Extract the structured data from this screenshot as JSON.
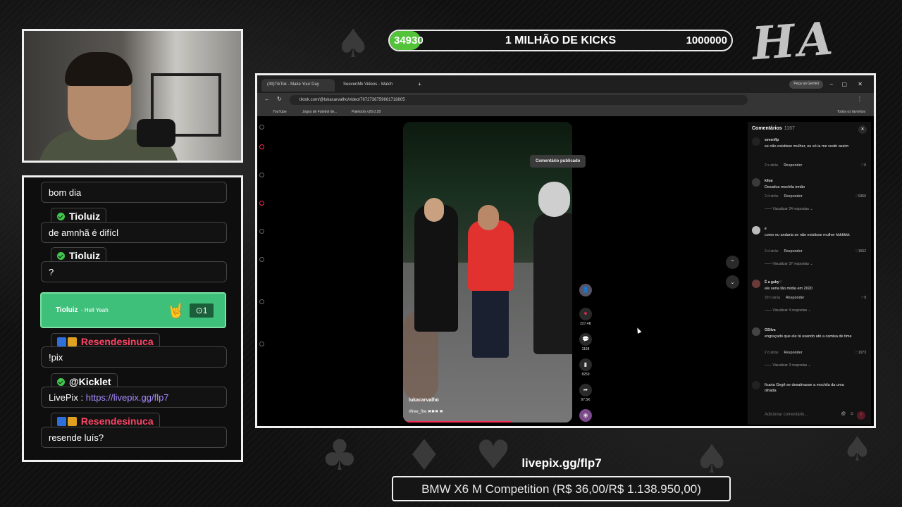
{
  "goal": {
    "current": "34930",
    "title": "1 MILHÃO DE KICKS",
    "target": "1000000",
    "progress_fraction": 0.03493,
    "accent": "#53c43a"
  },
  "overlay_text": "HA HA",
  "chat": {
    "messages": [
      {
        "text": "bom dia"
      },
      {
        "user": "Tioluiz",
        "text": "de amnhã é difícl"
      },
      {
        "user": "Tioluiz",
        "text": "?"
      },
      {
        "user": "Resendesinuca",
        "text": "!pix"
      },
      {
        "user": "@Kicklet",
        "text_prefix": "LivePix : ",
        "link": "https://livepix.gg/flp7"
      },
      {
        "user": "Resendesinuca",
        "text": "resende luís?"
      }
    ],
    "sub_alert": {
      "user": "Tioluiz",
      "text": "- Hell Yeah",
      "count": "1"
    },
    "colors": {
      "verified": "#3fc94d",
      "resende": "#ff4466",
      "link": "#a98bff",
      "alert": "#3fc07a"
    }
  },
  "browser": {
    "tabs": [
      {
        "label": "(39)TikTok - Make Your Day"
      },
      {
        "label": "SeevenMk Videos - Watch"
      }
    ],
    "gemini_label": "Peça ao Gemini",
    "url": "tiktok.com/@lukacarvalho/video/7672738759661718805",
    "bookmarks": [
      "YouTube",
      "Jogos de Futebol de...",
      "Paletools v26.0.28"
    ],
    "all_bookmarks": "Todos os favoritos"
  },
  "video": {
    "user": "lukacarvalho",
    "tags": "#free_fire ✖✖✖ ✖",
    "toast": "Comentário publicado",
    "progress_fraction": 0.64,
    "actions": [
      {
        "icon": "avatar-icon",
        "count": ""
      },
      {
        "icon": "heart-icon",
        "count": "227.4K"
      },
      {
        "icon": "comment-icon",
        "count": "1168"
      },
      {
        "icon": "bookmark-icon",
        "count": "8259"
      },
      {
        "icon": "share-icon",
        "count": "97.5K"
      }
    ]
  },
  "comments": {
    "title": "Comentários",
    "count": "1167",
    "items": [
      {
        "user": "sevenflp",
        "text": "se não existisse mulher, eu só ia me vestir assim",
        "time": "2 s atrás",
        "reply": "Responder",
        "likes": "0"
      },
      {
        "user": "kilua",
        "text": "Desativa mochila irmão",
        "time": "2 d atrás",
        "reply": "Responder",
        "likes": "9360",
        "more": "Visualizar 24 respostas"
      },
      {
        "user": "e",
        "text": "como eu andaria se não existisse mulher kkkkkkk",
        "time": "2 d atrás",
        "reply": "Responder",
        "likes": "1562",
        "more": "Visualizar 37 respostas"
      },
      {
        "user": "É a gaby♡",
        "text": "ele seria tão mídia em 2020",
        "time": "20 h atrás",
        "reply": "Responder",
        "likes": "9",
        "more": "Visualizar 4 respostas"
      },
      {
        "user": "GSilva",
        "text": "engraçado que ele tá usando até a camisa de time",
        "time": "2 d atrás",
        "reply": "Responder",
        "likes": "1073",
        "more": "Visualizar 3 respostas"
      },
      {
        "user": "",
        "text": "ficaria Gegê se desativasse a mochila da uma olhada"
      }
    ],
    "input_placeholder": "Adicionar comentário..."
  },
  "footer": {
    "link": "livepix.gg/flp7",
    "ticker": "BMW X6 M Competition (R$ 36,00/R$ 1.138.950,00)"
  }
}
